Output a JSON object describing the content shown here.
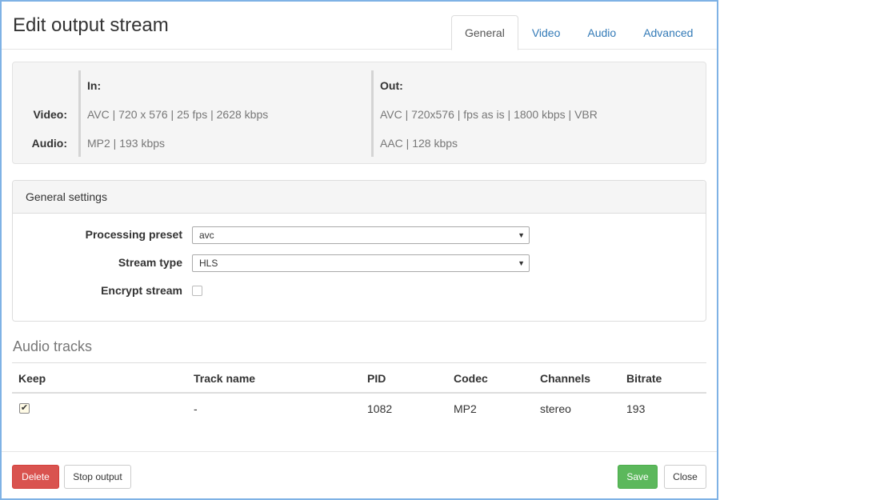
{
  "modal": {
    "title": "Edit output stream",
    "tabs": [
      {
        "label": "General"
      },
      {
        "label": "Video"
      },
      {
        "label": "Audio"
      },
      {
        "label": "Advanced"
      }
    ]
  },
  "summary": {
    "in_label": "In:",
    "out_label": "Out:",
    "video_label": "Video:",
    "audio_label": "Audio:",
    "in_video": "AVC | 720 x 576 | 25 fps | 2628 kbps",
    "in_audio": "MP2 | 193 kbps",
    "out_video": "AVC | 720x576 | fps as is | 1800 kbps | VBR",
    "out_audio": "AAC | 128 kbps"
  },
  "general_settings": {
    "heading": "General settings",
    "processing_preset_label": "Processing preset",
    "processing_preset_value": "avc",
    "stream_type_label": "Stream type",
    "stream_type_value": "HLS",
    "encrypt_stream_label": "Encrypt stream"
  },
  "audio_tracks": {
    "title": "Audio tracks",
    "columns": [
      "Keep",
      "Track name",
      "PID",
      "Codec",
      "Channels",
      "Bitrate"
    ],
    "rows": [
      {
        "track_name": "-",
        "pid": "1082",
        "codec": "MP2",
        "channels": "stereo",
        "bitrate": "193"
      }
    ]
  },
  "footer": {
    "delete_label": "Delete",
    "stop_output_label": "Stop output",
    "save_label": "Save",
    "close_label": "Close"
  },
  "colors": {
    "accent_link": "#337ab7",
    "danger": "#d9534f",
    "success": "#5cb85c",
    "modal_border": "#7fb2e5"
  },
  "icons": {
    "select_caret": "caret-down-icon",
    "checkbox_checked": "checkmark-icon"
  }
}
